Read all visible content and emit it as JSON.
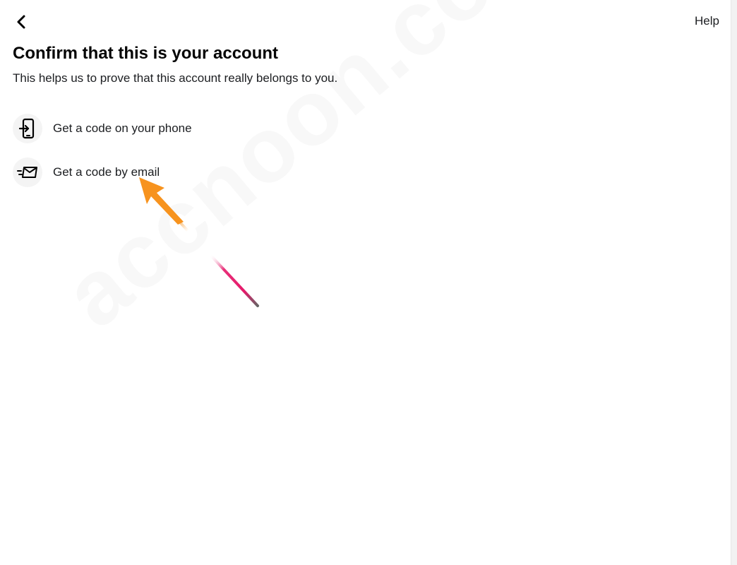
{
  "header": {
    "back_icon": "chevron-left-icon",
    "help_label": "Help"
  },
  "main": {
    "title": "Confirm that this is your account",
    "subtitle": "This helps us to prove that this account really belongs to you.",
    "options": [
      {
        "label": "Get a code on your phone",
        "icon": "phone-login-icon"
      },
      {
        "label": "Get a code by email",
        "icon": "email-send-icon"
      }
    ]
  },
  "watermark": {
    "text": "accnoon.com"
  },
  "annotation": {
    "arrow_color": "#f7931e",
    "pen_color": "#e5196a"
  }
}
